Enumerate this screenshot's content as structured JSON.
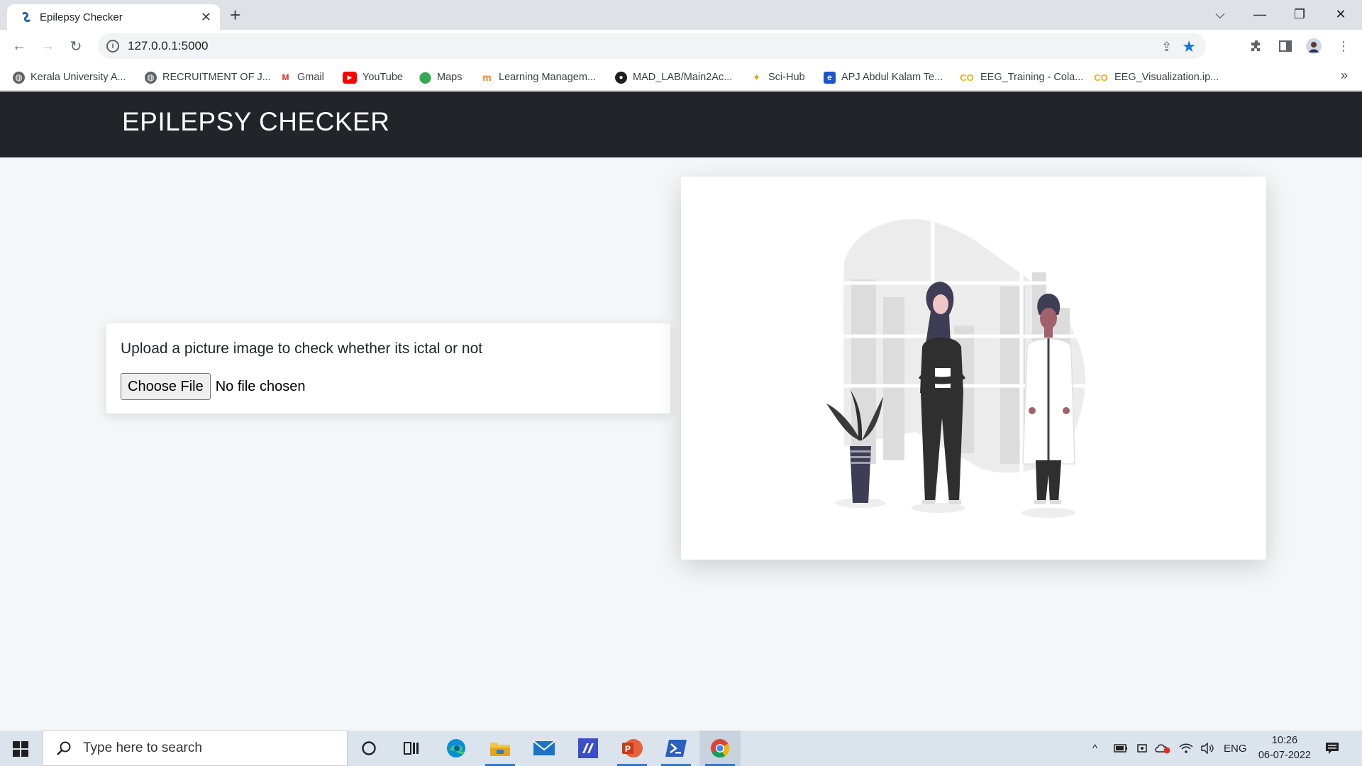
{
  "browser": {
    "tab_title": "Epilepsy Checker",
    "url": "127.0.0.1:5000",
    "bookmarks": [
      {
        "label": "Kerala University A...",
        "icon": "globe-icon"
      },
      {
        "label": "RECRUITMENT OF J...",
        "icon": "globe-icon"
      },
      {
        "label": "Gmail",
        "icon": "gmail-icon"
      },
      {
        "label": "YouTube",
        "icon": "youtube-icon"
      },
      {
        "label": "Maps",
        "icon": "maps-icon"
      },
      {
        "label": "Learning Managem...",
        "icon": "moodle-icon"
      },
      {
        "label": "MAD_LAB/Main2Ac...",
        "icon": "github-icon"
      },
      {
        "label": "Sci-Hub",
        "icon": "scihub-icon"
      },
      {
        "label": "APJ Abdul Kalam Te...",
        "icon": "ktu-icon"
      },
      {
        "label": "EEG_Training - Cola...",
        "icon": "colab-icon"
      },
      {
        "label": "EEG_Visualization.ip...",
        "icon": "colab-icon"
      }
    ]
  },
  "page": {
    "brand": "EPILEPSY CHECKER",
    "upload_prompt": "Upload a picture image to check whether its ictal or not",
    "file_button": "Choose File",
    "file_status": "No file chosen"
  },
  "taskbar": {
    "search_placeholder": "Type here to search",
    "language": "ENG",
    "time": "10:26",
    "date": "06-07-2022"
  },
  "colors": {
    "navbar": "#212529",
    "page_bg": "#f5f6f7",
    "accent": "#3a78c9"
  }
}
